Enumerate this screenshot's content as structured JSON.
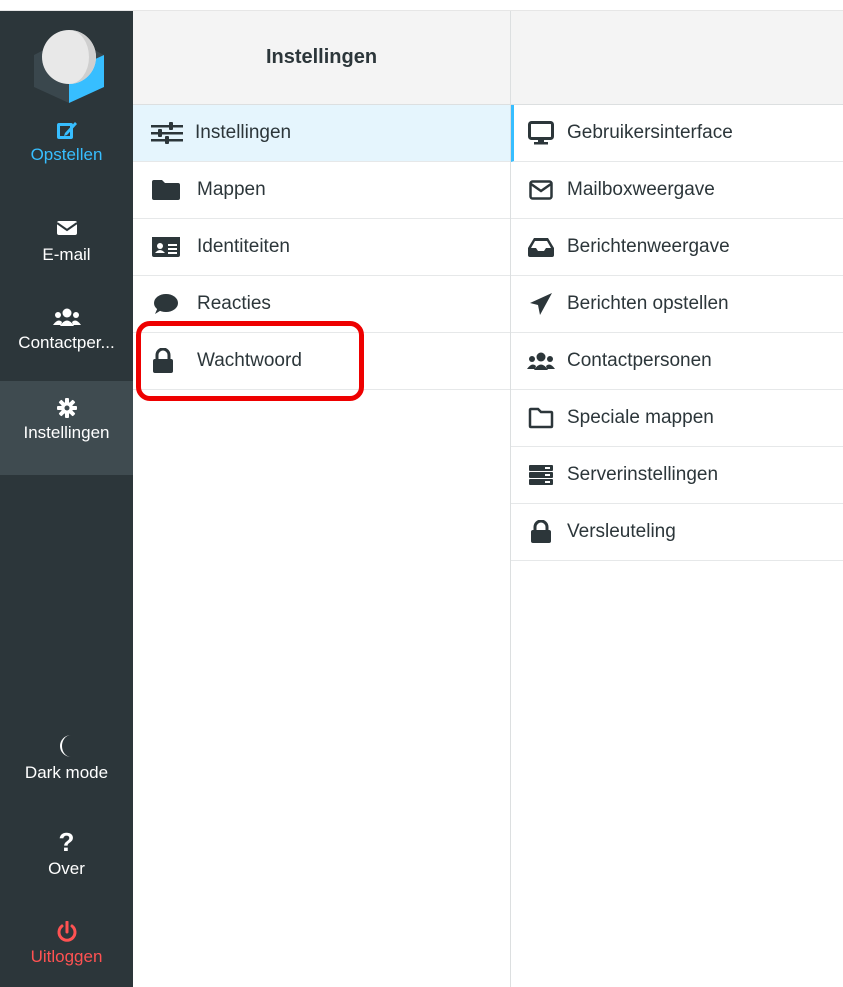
{
  "nav": {
    "items": [
      {
        "label": "Opstellen",
        "icon": "compose-icon"
      },
      {
        "label": "E-mail",
        "icon": "envelope-icon"
      },
      {
        "label": "Contactper...",
        "icon": "users-icon"
      },
      {
        "label": "Instellingen",
        "icon": "gear-icon"
      },
      {
        "label": "Dark mode",
        "icon": "moon-icon"
      },
      {
        "label": "Over",
        "icon": "question-icon"
      },
      {
        "label": "Uitloggen",
        "icon": "power-icon"
      }
    ],
    "accent_color": "#37beff",
    "logout_color": "#ff5252"
  },
  "middle": {
    "title": "Instellingen",
    "items": [
      {
        "label": "Instellingen",
        "icon": "sliders-icon"
      },
      {
        "label": "Mappen",
        "icon": "folder-icon"
      },
      {
        "label": "Identiteiten",
        "icon": "id-card-icon"
      },
      {
        "label": "Reacties",
        "icon": "comment-icon"
      },
      {
        "label": "Wachtwoord",
        "icon": "lock-icon"
      }
    ]
  },
  "right": {
    "items": [
      {
        "label": "Gebruikersinterface",
        "icon": "desktop-icon"
      },
      {
        "label": "Mailboxweergave",
        "icon": "envelope-outline-icon"
      },
      {
        "label": "Berichtenweergave",
        "icon": "inbox-icon"
      },
      {
        "label": "Berichten opstellen",
        "icon": "paper-plane-icon"
      },
      {
        "label": "Contactpersonen",
        "icon": "users-icon"
      },
      {
        "label": "Speciale mappen",
        "icon": "folder-outline-icon"
      },
      {
        "label": "Serverinstellingen",
        "icon": "server-icon"
      },
      {
        "label": "Versleuteling",
        "icon": "lock-icon"
      }
    ]
  }
}
